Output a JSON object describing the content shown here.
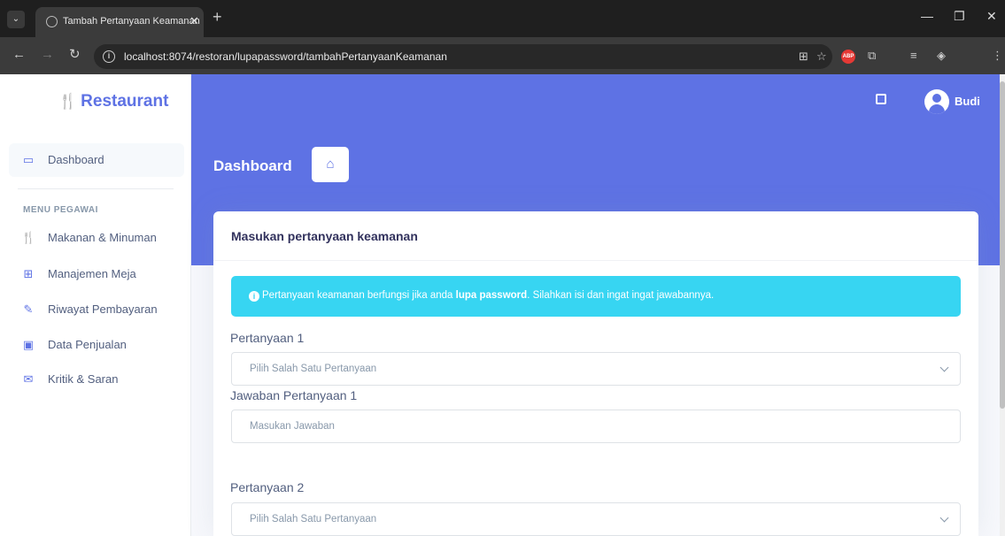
{
  "browser": {
    "tab_title": "Tambah Pertanyaan Keamanan",
    "url": "localhost:8074/restoran/lupapassword/tambahPertanyaanKeamanan"
  },
  "sidebar": {
    "brand": "Restaurant",
    "dashboard": "Dashboard",
    "heading": "MENU PEGAWAI",
    "items": [
      {
        "label": "Makanan & Minuman",
        "icon": "utensils-icon"
      },
      {
        "label": "Manajemen Meja",
        "icon": "table-icon"
      },
      {
        "label": "Riwayat Pembayaran",
        "icon": "edit-icon"
      },
      {
        "label": "Data Penjualan",
        "icon": "money-icon"
      },
      {
        "label": "Kritik & Saran",
        "icon": "envelope-icon"
      }
    ]
  },
  "header": {
    "user_name": "Budi",
    "page_title": "Dashboard",
    "accent_color": "#5e72e4"
  },
  "card": {
    "title": "Masukan pertanyaan keamanan",
    "alert_prefix": "Pertanyaan keamanan berfungsi jika anda ",
    "alert_bold": "lupa password",
    "alert_suffix": ". Silahkan isi dan ingat ingat jawabannya.",
    "q1_label": "Pertanyaan 1",
    "q1_select": "Pilih Salah Satu Pertanyaan",
    "a1_label": "Jawaban Pertanyaan 1",
    "a1_placeholder": "Masukan Jawaban",
    "q2_label": "Pertanyaan 2",
    "q2_select": "Pilih Salah Satu Pertanyaan"
  }
}
